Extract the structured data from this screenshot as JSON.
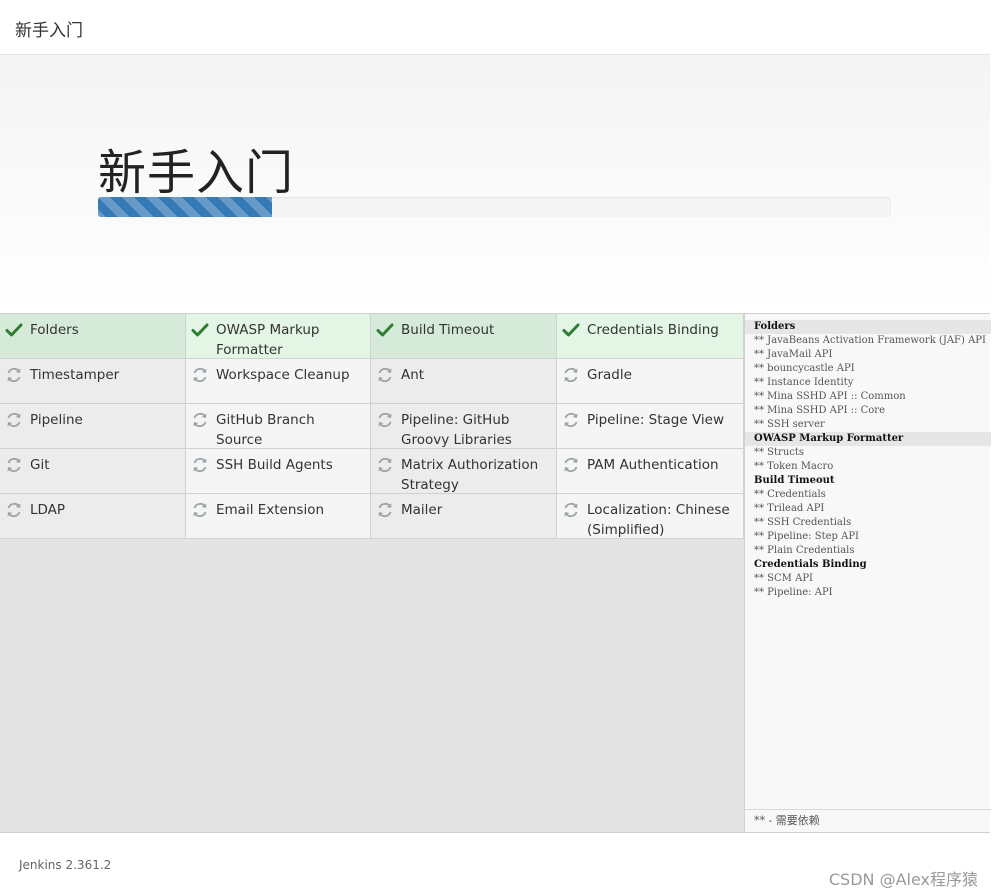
{
  "header": {
    "title": "新手入门"
  },
  "hero": {
    "title": "新手入门",
    "progress_fraction": 0.22
  },
  "plugins": [
    {
      "name": "Folders",
      "status": "done"
    },
    {
      "name": "OWASP Markup Formatter",
      "status": "done"
    },
    {
      "name": "Build Timeout",
      "status": "done"
    },
    {
      "name": "Credentials Binding",
      "status": "done"
    },
    {
      "name": "Timestamper",
      "status": "pending"
    },
    {
      "name": "Workspace Cleanup",
      "status": "pending"
    },
    {
      "name": "Ant",
      "status": "pending"
    },
    {
      "name": "Gradle",
      "status": "pending"
    },
    {
      "name": "Pipeline",
      "status": "pending"
    },
    {
      "name": "GitHub Branch Source",
      "status": "pending"
    },
    {
      "name": "Pipeline: GitHub Groovy Libraries",
      "status": "pending"
    },
    {
      "name": "Pipeline: Stage View",
      "status": "pending"
    },
    {
      "name": "Git",
      "status": "pending"
    },
    {
      "name": "SSH Build Agents",
      "status": "pending"
    },
    {
      "name": "Matrix Authorization Strategy",
      "status": "pending"
    },
    {
      "name": "PAM Authentication",
      "status": "pending"
    },
    {
      "name": "LDAP",
      "status": "pending"
    },
    {
      "name": "Email Extension",
      "status": "pending"
    },
    {
      "name": "Mailer",
      "status": "pending"
    },
    {
      "name": "Localization: Chinese (Simplified)",
      "status": "pending"
    }
  ],
  "log": [
    {
      "text": "Folders",
      "type": "head",
      "highlight": true
    },
    {
      "text": "** JavaBeans Activation Framework (JAF) API",
      "type": "dep"
    },
    {
      "text": "** JavaMail API",
      "type": "dep"
    },
    {
      "text": "** bouncycastle API",
      "type": "dep"
    },
    {
      "text": "** Instance Identity",
      "type": "dep"
    },
    {
      "text": "** Mina SSHD API :: Common",
      "type": "dep"
    },
    {
      "text": "** Mina SSHD API :: Core",
      "type": "dep"
    },
    {
      "text": "** SSH server",
      "type": "dep"
    },
    {
      "text": "OWASP Markup Formatter",
      "type": "head",
      "highlight": true
    },
    {
      "text": "** Structs",
      "type": "dep"
    },
    {
      "text": "** Token Macro",
      "type": "dep"
    },
    {
      "text": "Build Timeout",
      "type": "head"
    },
    {
      "text": "** Credentials",
      "type": "dep"
    },
    {
      "text": "** Trilead API",
      "type": "dep"
    },
    {
      "text": "** SSH Credentials",
      "type": "dep"
    },
    {
      "text": "** Pipeline: Step API",
      "type": "dep"
    },
    {
      "text": "** Plain Credentials",
      "type": "dep"
    },
    {
      "text": "Credentials Binding",
      "type": "head"
    },
    {
      "text": "** SCM API",
      "type": "dep"
    },
    {
      "text": "** Pipeline: API",
      "type": "dep"
    }
  ],
  "log_footer": "** - 需要依赖",
  "footer": {
    "version": "Jenkins 2.361.2",
    "watermark": "CSDN @Alex程序猿"
  },
  "colors": {
    "progress": "#337ab7",
    "check": "#2e7d32",
    "pending": "#9aa3a8"
  },
  "icons": {
    "done": "check-icon",
    "pending": "refresh-icon"
  }
}
